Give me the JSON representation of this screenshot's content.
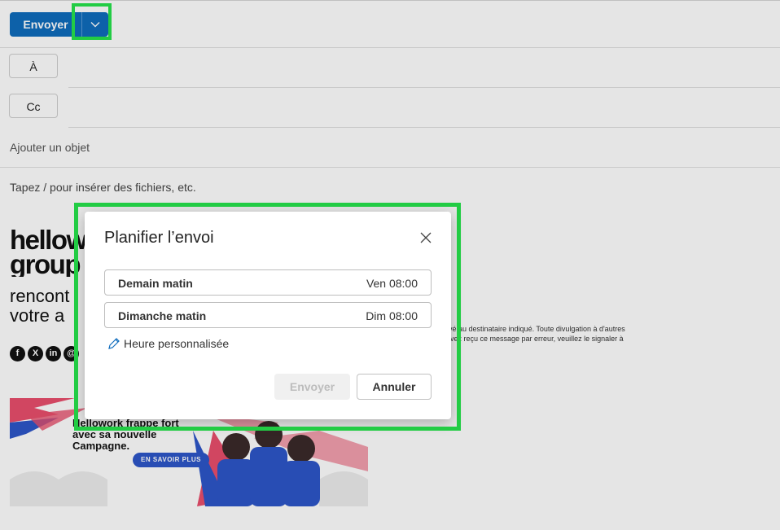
{
  "toolbar": {
    "send_label": "Envoyer"
  },
  "recipients": {
    "to_label": "À",
    "cc_label": "Cc"
  },
  "subject": {
    "placeholder": "Ajouter un objet"
  },
  "body": {
    "placeholder": "Tapez / pour insérer des fichiers, etc."
  },
  "signature": {
    "brand_lines": [
      "hellow",
      "group"
    ],
    "tagline_lines": [
      "rencont",
      "votre a"
    ],
    "social": [
      "f",
      "X",
      "in",
      "@"
    ],
    "disclaimer_lines": [
      "rvé au destinataire indiqué. Toute divulgation à d'autres",
      "avez reçu ce message par erreur, veuillez le signaler à"
    ],
    "banner": {
      "headline_lines": [
        "Hellowork frappe fort",
        "avec sa nouvelle",
        "Campagne."
      ],
      "cta": "EN SAVOIR PLUS"
    }
  },
  "dialog": {
    "title": "Planifier l’envoi",
    "options": [
      {
        "label": "Demain matin",
        "time": "Ven 08:00"
      },
      {
        "label": "Dimanche matin",
        "time": "Dim 08:00"
      }
    ],
    "custom_time": "Heure personnalisée",
    "send_label": "Envoyer",
    "cancel_label": "Annuler"
  },
  "colors": {
    "accent": "#0f6cbd",
    "highlight": "#22cc44"
  }
}
